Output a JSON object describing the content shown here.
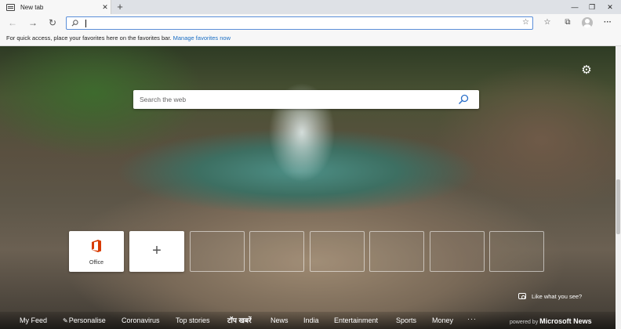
{
  "tab": {
    "title": "New tab",
    "close": "✕",
    "new_tab": "+"
  },
  "window": {
    "minimize": "—",
    "maximize": "❐",
    "close": "✕"
  },
  "toolbar": {
    "back": "←",
    "forward": "→",
    "refresh": "↻",
    "address_value": "",
    "address_placeholder": "",
    "favorite_star": "☆",
    "favorites": "☆",
    "collections": "⧉",
    "more": "···"
  },
  "favorites_bar": {
    "message": "For quick access, place your favorites here on the favorites bar.",
    "link": "Manage favorites now"
  },
  "page": {
    "settings": "⚙",
    "search_placeholder": "Search the web",
    "tiles": [
      {
        "label": "Office"
      },
      {
        "label": "+"
      }
    ],
    "like_label": "Like what you see?"
  },
  "bottom_nav": {
    "items": [
      "My Feed",
      "Personalise",
      "Coronavirus",
      "Top stories",
      "टॉप खबरें",
      "News",
      "India",
      "Entertainment",
      "Sports",
      "Money"
    ],
    "more": "···",
    "powered_by": "powered by",
    "brand": "Microsoft News"
  },
  "colors": {
    "accent": "#1a6ec4",
    "address_border": "#5b8fd9",
    "office_red": "#d83b01"
  },
  "icons": [
    "tab-page-icon",
    "back-icon",
    "forward-icon",
    "refresh-icon",
    "search-icon",
    "star-icon",
    "collections-icon",
    "profile-icon",
    "more-icon",
    "gear-icon",
    "office-icon",
    "plus-icon",
    "camera-icon",
    "pencil-icon"
  ]
}
